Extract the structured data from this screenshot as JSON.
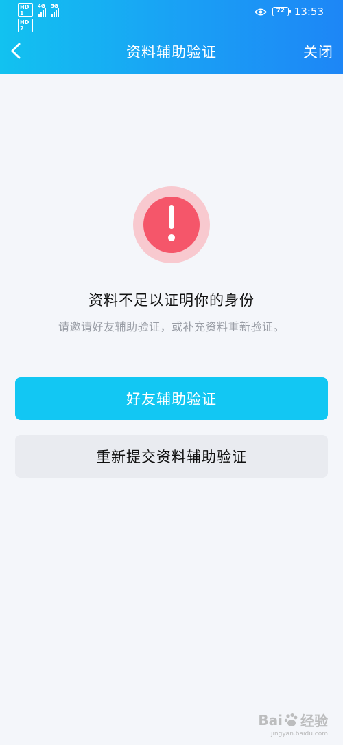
{
  "status_bar": {
    "sim1_label": "HD 1",
    "sim2_label": "HD 2",
    "net1": "4G",
    "net2": "5G",
    "battery": "72",
    "time": "13:53"
  },
  "nav": {
    "title": "资料辅助验证",
    "close_label": "关闭",
    "back_icon": "chevron-left-icon"
  },
  "alert": {
    "icon": "exclamation-circle-icon",
    "title": "资料不足以证明你的身份",
    "subtitle": "请邀请好友辅助验证，或补充资料重新验证。"
  },
  "actions": {
    "primary_label": "好友辅助验证",
    "secondary_label": "重新提交资料辅助验证"
  },
  "watermark": {
    "brand": "Bai",
    "brand_suffix": "经验",
    "url": "jingyan.baidu.com"
  },
  "colors": {
    "header_start": "#12c2f0",
    "header_end": "#1d86f6",
    "primary_button": "#12c7f3",
    "alert_red": "#f5566a",
    "alert_halo": "#f8c9cf"
  }
}
